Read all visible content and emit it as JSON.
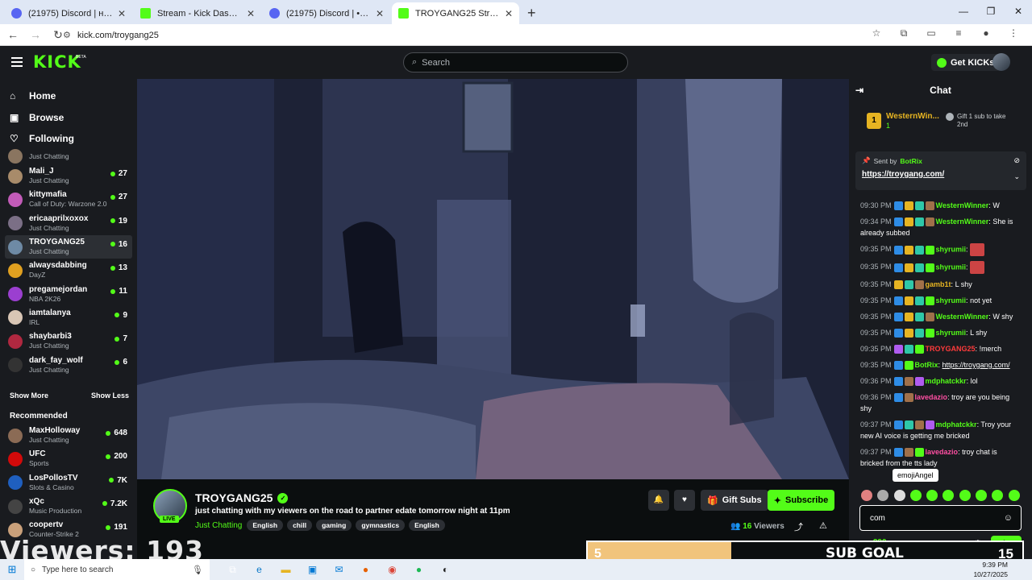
{
  "browser": {
    "tabs": [
      {
        "label": "(21975) Discord | ʜᴇᴀᴠʏ | Walki...",
        "icon": "discord-icon",
        "active": false
      },
      {
        "label": "Stream - Kick Dashboard",
        "icon": "kick-icon",
        "active": false
      },
      {
        "label": "(21975) Discord | • VC 1 | S...",
        "icon": "discord-icon",
        "active": false
      },
      {
        "label": "TROYGANG25 Stream - Watch ...",
        "icon": "kick-icon",
        "active": true
      }
    ],
    "url": "kick.com/troygang25"
  },
  "header": {
    "logo": "KICK",
    "beta": "BETA",
    "search_placeholder": "Search",
    "get_kicks": "Get KICKs"
  },
  "sidebar": {
    "nav": [
      {
        "label": "Home",
        "icon": "home-icon"
      },
      {
        "label": "Browse",
        "icon": "browse-icon"
      },
      {
        "label": "Following",
        "icon": "heart-icon"
      }
    ],
    "following": [
      {
        "name": "Mali_J",
        "category": "Just Chatting",
        "viewers": "27"
      },
      {
        "name": "kittymafia",
        "category": "Call of Duty: Warzone 2.0",
        "viewers": "27"
      },
      {
        "name": "ericaaprilxoxox",
        "category": "Just Chatting",
        "viewers": "19"
      },
      {
        "name": "TROYGANG25",
        "category": "Just Chatting",
        "viewers": "16"
      },
      {
        "name": "alwaysdabbing",
        "category": "DayZ",
        "viewers": "13"
      },
      {
        "name": "pregamejordan",
        "category": "NBA 2K26",
        "viewers": "11"
      },
      {
        "name": "iamtalanya",
        "category": "IRL",
        "viewers": "9"
      },
      {
        "name": "shaybarbi3",
        "category": "Just Chatting",
        "viewers": "7"
      },
      {
        "name": "dark_fay_wolf",
        "category": "Just Chatting",
        "viewers": "6"
      }
    ],
    "partial_item": {
      "name": "Just Chatting"
    },
    "show_more": "Show More",
    "show_less": "Show Less",
    "recommended_label": "Recommended",
    "recommended": [
      {
        "name": "MaxHolloway",
        "category": "Just Chatting",
        "viewers": "648"
      },
      {
        "name": "UFC",
        "category": "Sports",
        "viewers": "200"
      },
      {
        "name": "LosPollosTV",
        "category": "Slots & Casino",
        "viewers": "7K"
      },
      {
        "name": "xQc",
        "category": "Music Production",
        "viewers": "7.2K"
      },
      {
        "name": "coopertv",
        "category": "Counter-Strike 2",
        "viewers": "191"
      }
    ]
  },
  "stream": {
    "channel": "TROYGANG25",
    "live": "LIVE",
    "title": "just chatting with my viewers on the road to partner edate tomorrow night at 11pm",
    "category": "Just Chatting",
    "tags": [
      "English",
      "chill",
      "gaming",
      "gymnastics",
      "English"
    ],
    "gift_subs": "Gift Subs",
    "subscribe": "Subscribe",
    "viewers_count": "16",
    "viewers_label": "Viewers",
    "overlay_viewers": "Viewers: 193"
  },
  "chat": {
    "title": "Chat",
    "top_gifter": {
      "rank": "1",
      "name": "WesternWin...",
      "count": "1",
      "side": "Gift 1 sub to take 2nd"
    },
    "pinned": {
      "sent_by": "Sent by",
      "bot": "BotRix",
      "link": "https://troygang.com/"
    },
    "messages": [
      {
        "time": "09:30 PM",
        "user": "WesternWinner",
        "color": "#53fc18",
        "text": "W",
        "badges": [
          "b1",
          "b2",
          "b3",
          "b4"
        ]
      },
      {
        "time": "09:34 PM",
        "user": "WesternWinner",
        "color": "#53fc18",
        "text": "She is already subbed",
        "badges": [
          "b1",
          "b2",
          "b3",
          "b4"
        ]
      },
      {
        "time": "09:35 PM",
        "user": "shyrumii",
        "color": "#53fc18",
        "text": "",
        "emote": true,
        "badges": [
          "b1",
          "b2",
          "b3",
          "b5"
        ]
      },
      {
        "time": "09:35 PM",
        "user": "shyrumii",
        "color": "#53fc18",
        "text": "",
        "emote": true,
        "badges": [
          "b1",
          "b2",
          "b3",
          "b5"
        ]
      },
      {
        "time": "09:35 PM",
        "user": "gamb1t",
        "color": "#e6b422",
        "text": "L shy",
        "badges": [
          "b2",
          "b3",
          "b4"
        ]
      },
      {
        "time": "09:35 PM",
        "user": "shyrumii",
        "color": "#53fc18",
        "text": "not yet",
        "badges": [
          "b1",
          "b2",
          "b3",
          "b5"
        ]
      },
      {
        "time": "09:35 PM",
        "user": "WesternWinner",
        "color": "#53fc18",
        "text": "W shy",
        "badges": [
          "b1",
          "b2",
          "b3",
          "b4"
        ]
      },
      {
        "time": "09:35 PM",
        "user": "shyrumii",
        "color": "#53fc18",
        "text": "L shy",
        "badges": [
          "b1",
          "b2",
          "b3",
          "b5"
        ]
      },
      {
        "time": "09:35 PM",
        "user": "TROYGANG25",
        "color": "#ff3b3b",
        "text": "!merch",
        "badges": [
          "b6",
          "b3",
          "b5"
        ]
      },
      {
        "time": "09:35 PM",
        "user": "BotRix",
        "color": "#53fc18",
        "text": "https://troygang.com/",
        "link": true,
        "badges": [
          "b1",
          "b5"
        ]
      },
      {
        "time": "09:36 PM",
        "user": "mdphatckkr",
        "color": "#53fc18",
        "text": "lol",
        "badges": [
          "b1",
          "b4",
          "b6"
        ]
      },
      {
        "time": "09:36 PM",
        "user": "lavedazio",
        "color": "#ff4fa3",
        "text": "troy are you being shy",
        "badges": [
          "b1",
          "b4"
        ]
      },
      {
        "time": "09:37 PM",
        "user": "mdphatckkr",
        "color": "#53fc18",
        "text": "Troy your new AI voice is getting me bricked",
        "badges": [
          "b1",
          "b3",
          "b4",
          "b6"
        ]
      },
      {
        "time": "09:37 PM",
        "user": "lavedazio",
        "color": "#ff4fa3",
        "text": "troy chat is bricked from the tts lady",
        "badges": [
          "b1",
          "b4",
          "b5"
        ]
      }
    ],
    "tooltip": "emojiAngel",
    "input_value": "com",
    "kicks": "290",
    "send": "Chat"
  },
  "subgoal": {
    "current": "5",
    "label": "SUB GOAL",
    "target": "15",
    "progress": 0.33
  },
  "taskbar": {
    "search_placeholder": "Type here to search",
    "time": "9:39 PM",
    "date": "10/27/2025"
  }
}
